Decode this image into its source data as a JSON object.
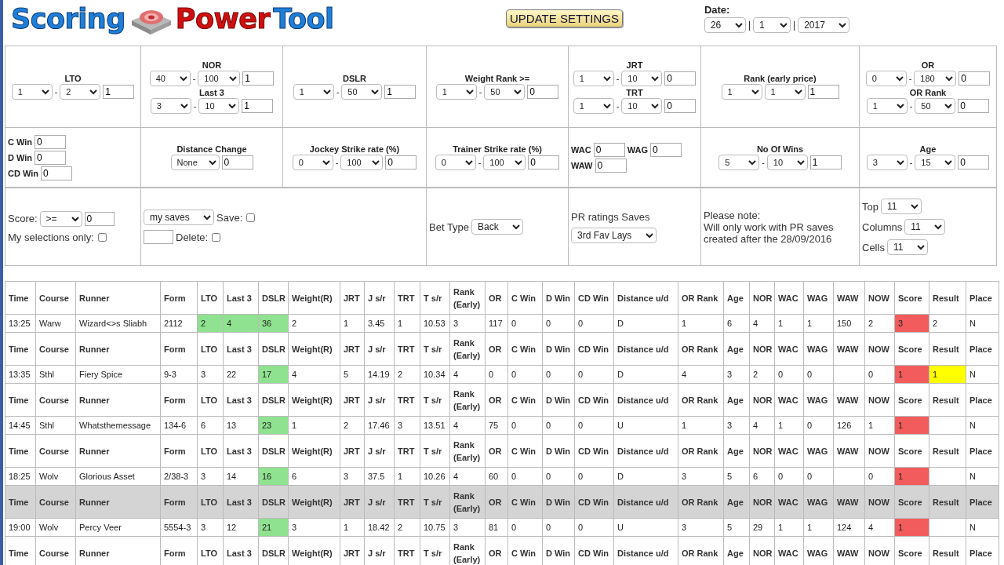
{
  "logo": {
    "left": "Scoring",
    "middle": "Power",
    "right": "Tool"
  },
  "update_button": "UPDATE SETTINGS",
  "date": {
    "label": "Date:",
    "separator": "|",
    "day": "26",
    "month": "1",
    "year": "2017"
  },
  "filters": {
    "rows": [
      {
        "cells": [
          {
            "groups": [
              {
                "label": "LTO",
                "controls": [
                  {
                    "kind": "select",
                    "value": "1"
                  },
                  {
                    "kind": "sep",
                    "text": "-"
                  },
                  {
                    "kind": "select",
                    "value": "2"
                  },
                  {
                    "kind": "input",
                    "value": "1"
                  }
                ]
              }
            ]
          },
          {
            "groups": [
              {
                "label": "NOR",
                "controls": [
                  {
                    "kind": "select",
                    "value": "40"
                  },
                  {
                    "kind": "sep",
                    "text": "-"
                  },
                  {
                    "kind": "select",
                    "value": "100"
                  },
                  {
                    "kind": "input",
                    "value": "1"
                  }
                ]
              },
              {
                "label": "Last 3",
                "controls": [
                  {
                    "kind": "select",
                    "value": "3"
                  },
                  {
                    "kind": "sep",
                    "text": "-"
                  },
                  {
                    "kind": "select",
                    "value": "10"
                  },
                  {
                    "kind": "input",
                    "value": "1"
                  }
                ]
              }
            ]
          },
          {
            "groups": [
              {
                "label": "DSLR",
                "controls": [
                  {
                    "kind": "select",
                    "value": "1"
                  },
                  {
                    "kind": "sep",
                    "text": "-"
                  },
                  {
                    "kind": "select",
                    "value": "50"
                  },
                  {
                    "kind": "input",
                    "value": "1"
                  }
                ]
              }
            ]
          },
          {
            "groups": [
              {
                "label": "Weight Rank >=",
                "controls": [
                  {
                    "kind": "select",
                    "value": "1"
                  },
                  {
                    "kind": "sep",
                    "text": "-"
                  },
                  {
                    "kind": "select",
                    "value": "50"
                  },
                  {
                    "kind": "input",
                    "value": "0"
                  }
                ]
              }
            ]
          },
          {
            "groups": [
              {
                "label": "JRT",
                "controls": [
                  {
                    "kind": "select",
                    "value": "1"
                  },
                  {
                    "kind": "sep",
                    "text": "-"
                  },
                  {
                    "kind": "select",
                    "value": "10"
                  },
                  {
                    "kind": "input",
                    "value": "0"
                  }
                ]
              },
              {
                "label": "TRT",
                "controls": [
                  {
                    "kind": "select",
                    "value": "1"
                  },
                  {
                    "kind": "sep",
                    "text": "-"
                  },
                  {
                    "kind": "select",
                    "value": "10"
                  },
                  {
                    "kind": "input",
                    "value": "0"
                  }
                ]
              }
            ]
          },
          {
            "groups": [
              {
                "label": "Rank (early price)",
                "controls": [
                  {
                    "kind": "select",
                    "value": "1"
                  },
                  {
                    "kind": "select",
                    "value": "1"
                  },
                  {
                    "kind": "input",
                    "value": "1"
                  }
                ]
              }
            ]
          },
          {
            "groups": [
              {
                "label": "OR",
                "controls": [
                  {
                    "kind": "select",
                    "value": "0"
                  },
                  {
                    "kind": "sep",
                    "text": "-"
                  },
                  {
                    "kind": "select",
                    "value": "180"
                  },
                  {
                    "kind": "input",
                    "value": "0"
                  }
                ]
              },
              {
                "label": "OR Rank",
                "controls": [
                  {
                    "kind": "select",
                    "value": "1"
                  },
                  {
                    "kind": "sep",
                    "text": "-"
                  },
                  {
                    "kind": "select",
                    "value": "50"
                  },
                  {
                    "kind": "input",
                    "value": "0"
                  }
                ]
              }
            ]
          }
        ]
      },
      {
        "cells": [
          {
            "groups": [
              {
                "controls": [
                  {
                    "kind": "label",
                    "text": "C Win"
                  },
                  {
                    "kind": "input",
                    "value": "0"
                  }
                ]
              },
              {
                "controls": [
                  {
                    "kind": "label",
                    "text": "D Win"
                  },
                  {
                    "kind": "input",
                    "value": "0"
                  }
                ]
              },
              {
                "controls": [
                  {
                    "kind": "label",
                    "text": "CD Win"
                  },
                  {
                    "kind": "input",
                    "value": "0"
                  }
                ]
              }
            ]
          },
          {
            "groups": [
              {
                "label": "Distance Change",
                "controls": [
                  {
                    "kind": "select",
                    "value": "None"
                  },
                  {
                    "kind": "input",
                    "value": "0"
                  }
                ]
              }
            ]
          },
          {
            "groups": [
              {
                "label": "Jockey Strike rate (%)",
                "controls": [
                  {
                    "kind": "select",
                    "value": "0"
                  },
                  {
                    "kind": "sep",
                    "text": "-"
                  },
                  {
                    "kind": "select",
                    "value": "100"
                  },
                  {
                    "kind": "input",
                    "value": "0"
                  }
                ]
              }
            ]
          },
          {
            "groups": [
              {
                "label": "Trainer Strike rate (%)",
                "controls": [
                  {
                    "kind": "select",
                    "value": "0"
                  },
                  {
                    "kind": "sep",
                    "text": "-"
                  },
                  {
                    "kind": "select",
                    "value": "100"
                  },
                  {
                    "kind": "input",
                    "value": "0"
                  }
                ]
              }
            ]
          },
          {
            "groups": [
              {
                "controls": [
                  {
                    "kind": "label",
                    "text": "WAC"
                  },
                  {
                    "kind": "input",
                    "value": "0"
                  },
                  {
                    "kind": "label",
                    "text": "WAG"
                  },
                  {
                    "kind": "input",
                    "value": "0"
                  }
                ]
              },
              {
                "controls": [
                  {
                    "kind": "label",
                    "text": "WAW"
                  },
                  {
                    "kind": "input",
                    "value": "0"
                  }
                ]
              }
            ]
          },
          {
            "groups": [
              {
                "label": "No Of Wins",
                "controls": [
                  {
                    "kind": "select",
                    "value": "5"
                  },
                  {
                    "kind": "sep",
                    "text": "-"
                  },
                  {
                    "kind": "select",
                    "value": "10"
                  },
                  {
                    "kind": "input",
                    "value": "1"
                  }
                ]
              }
            ]
          },
          {
            "groups": [
              {
                "label": "Age",
                "controls": [
                  {
                    "kind": "select",
                    "value": "3"
                  },
                  {
                    "kind": "sep",
                    "text": "-"
                  },
                  {
                    "kind": "select",
                    "value": "15"
                  },
                  {
                    "kind": "input",
                    "value": "0"
                  }
                ]
              }
            ]
          }
        ]
      }
    ]
  },
  "options": {
    "cells": [
      {
        "groups": [
          {
            "controls": [
              {
                "kind": "text",
                "text": "Score:"
              },
              {
                "kind": "select",
                "value": ">="
              },
              {
                "kind": "input",
                "value": "0"
              }
            ]
          },
          {
            "controls": [
              {
                "kind": "text",
                "text": "My selections only:"
              },
              {
                "kind": "checkbox",
                "checked": false
              }
            ]
          }
        ]
      },
      {
        "groups": [
          {
            "controls": [
              {
                "kind": "select",
                "value": "my saves"
              },
              {
                "kind": "text",
                "text": "Save:"
              },
              {
                "kind": "checkbox",
                "checked": false
              }
            ]
          },
          {
            "controls": [
              {
                "kind": "input"
              },
              {
                "kind": "text",
                "text": "Delete:"
              },
              {
                "kind": "checkbox",
                "checked": false
              }
            ]
          }
        ]
      },
      {
        "groups": [
          {
            "controls": [
              {
                "kind": "text",
                "text": "Bet Type"
              },
              {
                "kind": "select",
                "value": "Back"
              }
            ]
          }
        ]
      },
      {
        "groups": [
          {
            "controls": [
              {
                "kind": "text",
                "text": "PR ratings Saves"
              }
            ]
          },
          {
            "controls": [
              {
                "kind": "select",
                "value": "3rd Fav Lays"
              }
            ]
          }
        ]
      },
      {
        "groups": [
          {
            "controls": [
              {
                "kind": "text",
                "text": "Please note:\nWill only work with PR saves\ncreated after the 28/09/2016"
              }
            ]
          }
        ]
      },
      {
        "groups": [
          {
            "controls": [
              {
                "kind": "text",
                "text": "Top"
              },
              {
                "kind": "select",
                "value": "11"
              }
            ]
          },
          {
            "controls": [
              {
                "kind": "text",
                "text": "Columns"
              },
              {
                "kind": "select",
                "value": "11"
              }
            ]
          },
          {
            "controls": [
              {
                "kind": "text",
                "text": "Cells"
              },
              {
                "kind": "select",
                "value": "11"
              }
            ]
          }
        ]
      }
    ]
  },
  "results": {
    "blocks": [
      {
        "header": {
          "hovered": false,
          "cells": [
            "Time",
            "Course",
            "Runner",
            "Form",
            "LTO",
            "Last 3",
            "DSLR",
            "Weight(R)",
            "JRT",
            "J s/r",
            "TRT",
            "T s/r",
            "Rank (Early)",
            "OR",
            "C Win",
            "D Win",
            "CD Win",
            "Distance u/d",
            "OR Rank",
            "Age",
            "NOR",
            "WAC",
            "WAG",
            "WAW",
            "NOW",
            "Score",
            "Result",
            "Place"
          ]
        },
        "row": {
          "time": "13:25",
          "course": "Warw",
          "runner": "Wizard<>s Sliabh",
          "form": "2112",
          "lto": {
            "text": "2",
            "color": "#8fe28f"
          },
          "last3": {
            "text": "4",
            "color": "#8fe28f"
          },
          "dslr": {
            "text": "36",
            "color": "#8fe28f"
          },
          "weight": "2",
          "jrt": "1",
          "jsr": "3.45",
          "trt": "1",
          "tsr": "10.53",
          "rank": "3",
          "or": "117",
          "cwin": "0",
          "dwin": "0",
          "cdwin": "0",
          "distance": "D",
          "orrank": "1",
          "age": "6",
          "nor": "4",
          "wac": "1",
          "wag": "1",
          "waw": "150",
          "now": "2",
          "score": {
            "text": "3",
            "color": "#f25c5c"
          },
          "result": "2",
          "place": "N"
        }
      },
      {
        "header": {
          "hovered": false,
          "cells": [
            "Time",
            "Course",
            "Runner",
            "Form",
            "LTO",
            "Last 3",
            "DSLR",
            "Weight(R)",
            "JRT",
            "J s/r",
            "TRT",
            "T s/r",
            "Rank (Early)",
            "OR",
            "C Win",
            "D Win",
            "CD Win",
            "Distance u/d",
            "OR Rank",
            "Age",
            "NOR",
            "WAC",
            "WAG",
            "WAW",
            "NOW",
            "Score",
            "Result",
            "Place"
          ]
        },
        "row": {
          "time": "13:35",
          "course": "Sthl",
          "runner": "Fiery Spice",
          "form": "9-3",
          "lto": "3",
          "last3": "22",
          "dslr": {
            "text": "17",
            "color": "#8fe28f"
          },
          "weight": "4",
          "jrt": "5",
          "jsr": "14.19",
          "trt": "2",
          "tsr": "10.34",
          "rank": "4",
          "or": "0",
          "cwin": "0",
          "dwin": "0",
          "cdwin": "0",
          "distance": "D",
          "orrank": "4",
          "age": "3",
          "nor": "2",
          "wac": "0",
          "wag": "0",
          "now": "0",
          "score": {
            "text": "1",
            "color": "#f25c5c"
          },
          "result": {
            "text": "1",
            "color": "#ffff00"
          },
          "place": "N"
        }
      },
      {
        "header": {
          "hovered": false,
          "cells": [
            "Time",
            "Course",
            "Runner",
            "Form",
            "LTO",
            "Last 3",
            "DSLR",
            "Weight(R)",
            "JRT",
            "J s/r",
            "TRT",
            "T s/r",
            "Rank (Early)",
            "OR",
            "C Win",
            "D Win",
            "CD Win",
            "Distance u/d",
            "OR Rank",
            "Age",
            "NOR",
            "WAC",
            "WAG",
            "WAW",
            "NOW",
            "Score",
            "Result",
            "Place"
          ]
        },
        "row": {
          "time": "14:45",
          "course": "Sthl",
          "runner": "Whatsthemessage",
          "form": "134-6",
          "lto": "6",
          "last3": "13",
          "dslr": {
            "text": "23",
            "color": "#8fe28f"
          },
          "weight": "1",
          "jrt": "2",
          "jsr": "17.46",
          "trt": "3",
          "tsr": "13.51",
          "rank": "4",
          "or": "75",
          "cwin": "0",
          "dwin": "0",
          "cdwin": "0",
          "distance": "U",
          "orrank": "1",
          "age": "3",
          "nor": "4",
          "wac": "1",
          "wag": "0",
          "waw": "126",
          "now": "1",
          "score": {
            "text": "1",
            "color": "#f25c5c"
          },
          "place": "N"
        }
      },
      {
        "header": {
          "hovered": false,
          "cells": [
            "Time",
            "Course",
            "Runner",
            "Form",
            "LTO",
            "Last 3",
            "DSLR",
            "Weight(R)",
            "JRT",
            "J s/r",
            "TRT",
            "T s/r",
            "Rank (Early)",
            "OR",
            "C Win",
            "D Win",
            "CD Win",
            "Distance u/d",
            "OR Rank",
            "Age",
            "NOR",
            "WAC",
            "WAG",
            "WAW",
            "NOW",
            "Score",
            "Result",
            "Place"
          ]
        },
        "row": {
          "time": "18:25",
          "course": "Wolv",
          "runner": "Glorious Asset",
          "form": "2/38-3",
          "lto": "3",
          "last3": "14",
          "dslr": {
            "text": "16",
            "color": "#8fe28f"
          },
          "weight": "6",
          "jrt": "3",
          "jsr": "37.5",
          "trt": "1",
          "tsr": "10.26",
          "rank": "4",
          "or": "60",
          "cwin": "0",
          "dwin": "0",
          "cdwin": "0",
          "distance": "D",
          "orrank": "3",
          "age": "5",
          "nor": "6",
          "wac": "0",
          "wag": "0",
          "now": "0",
          "score": {
            "text": "1",
            "color": "#f25c5c"
          },
          "place": "N"
        }
      },
      {
        "header": {
          "hovered": true,
          "cells": [
            "Time",
            "Course",
            "Runner",
            "Form",
            "LTO",
            "Last 3",
            "DSLR",
            "Weight(R)",
            "JRT",
            "J s/r",
            "TRT",
            "T s/r",
            "Rank (Early)",
            "OR",
            "C Win",
            "D Win",
            "CD Win",
            "Distance u/d",
            "OR Rank",
            "Age",
            "NOR",
            "WAC",
            "WAG",
            "WAW",
            "NOW",
            "Score",
            "Result",
            "Place"
          ]
        },
        "row": {
          "time": "19:00",
          "course": "Wolv",
          "runner": "Percy Veer",
          "form": "5554-3",
          "lto": "3",
          "last3": "12",
          "dslr": {
            "text": "21",
            "color": "#8fe28f"
          },
          "weight": "3",
          "jrt": "1",
          "jsr": "18.42",
          "trt": "2",
          "tsr": "10.75",
          "rank": "3",
          "or": "81",
          "cwin": "0",
          "dwin": "0",
          "cdwin": "0",
          "distance": "U",
          "orrank": "3",
          "age": "5",
          "nor": "29",
          "wac": "1",
          "wag": "1",
          "waw": "124",
          "now": "4",
          "score": {
            "text": "1",
            "color": "#f25c5c"
          },
          "place": "N"
        }
      },
      {
        "header": {
          "hovered": false,
          "cells": [
            "Time",
            "Course",
            "Runner",
            "Form",
            "LTO",
            "Last 3",
            "DSLR",
            "Weight(R)",
            "JRT",
            "J s/r",
            "TRT",
            "T s/r",
            "Rank (Early)",
            "OR",
            "C Win",
            "D Win",
            "CD Win",
            "Distance u/d",
            "OR Rank",
            "Age",
            "NOR",
            "WAC",
            "WAG",
            "WAW",
            "NOW",
            "Score",
            "Result",
            "Place"
          ]
        }
      }
    ]
  }
}
